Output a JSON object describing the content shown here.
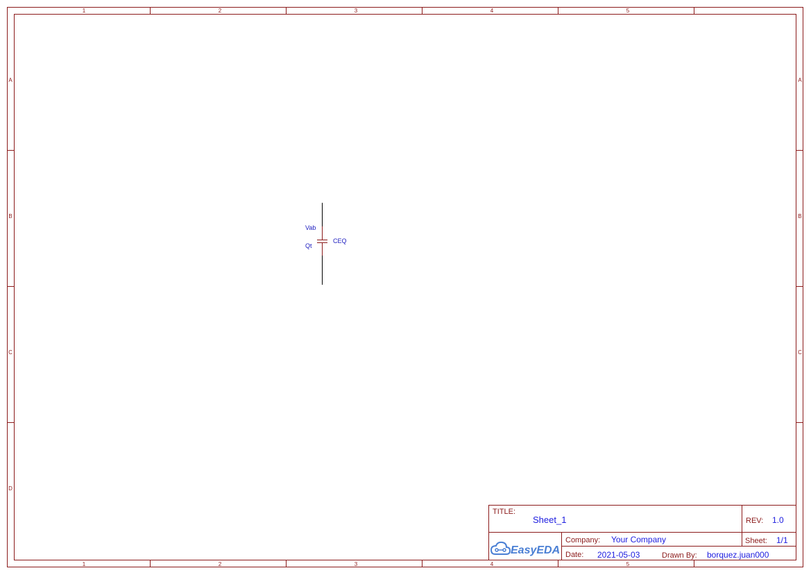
{
  "frame": {
    "col_labels": [
      "1",
      "2",
      "3",
      "4",
      "5"
    ],
    "row_labels": [
      "A",
      "B",
      "C",
      "D"
    ],
    "color": "#8b1a1a"
  },
  "component": {
    "net_top": "Vab",
    "net_bottom": "Qt",
    "designator": "CEQ"
  },
  "title_block": {
    "title_label": "TITLE:",
    "title_value": "Sheet_1",
    "rev_label": "REV:",
    "rev_value": "1.0",
    "company_label": "Company:",
    "company_value": "Your Company",
    "sheet_label": "Sheet:",
    "sheet_value": "1/1",
    "date_label": "Date:",
    "date_value": "2021-05-03",
    "drawn_by_label": "Drawn By:",
    "drawn_by_value": "borquez.juan000",
    "logo_text": "EasyEDA",
    "value_color": "#2020e0"
  }
}
